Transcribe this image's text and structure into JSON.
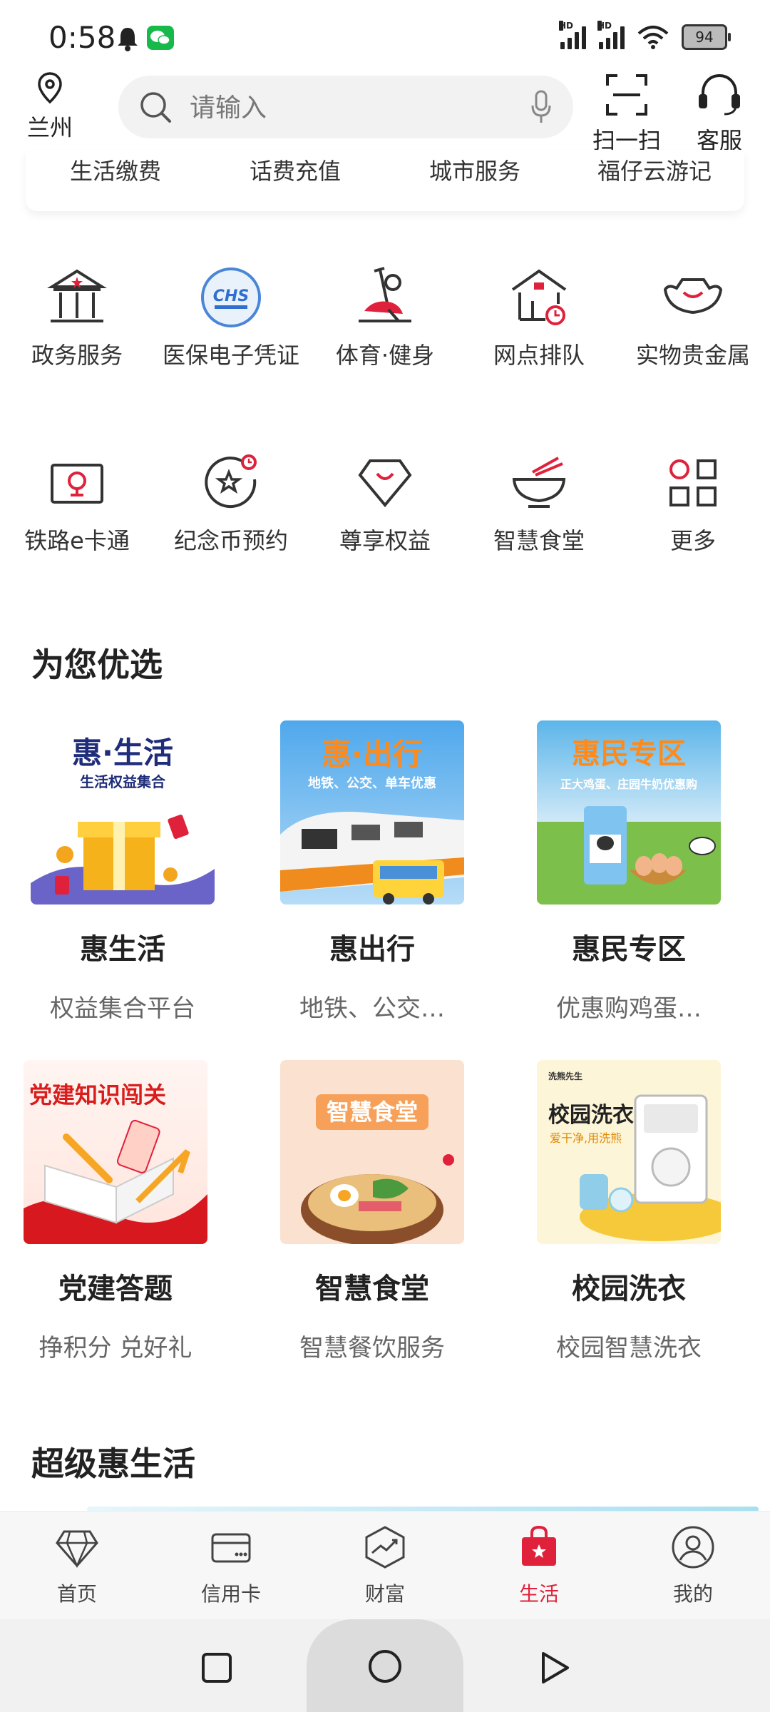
{
  "status_bar": {
    "time": "0:58",
    "battery": "94"
  },
  "header": {
    "location": "兰州",
    "search_placeholder": "请输入",
    "scan_label": "扫一扫",
    "service_label": "客服"
  },
  "quick_links": [
    "生活缴费",
    "话费充值",
    "城市服务",
    "福仔云游记"
  ],
  "grid": [
    {
      "label": "政务服务",
      "icon": "government-icon"
    },
    {
      "label": "医保电子凭证",
      "icon": "chs-medical-insurance-icon"
    },
    {
      "label": "体育·健身",
      "icon": "exercise-bike-icon"
    },
    {
      "label": "网点排队",
      "icon": "branch-queue-icon"
    },
    {
      "label": "实物贵金属",
      "icon": "gold-ingot-icon"
    },
    {
      "label": "铁路e卡通",
      "icon": "railway-card-icon"
    },
    {
      "label": "纪念币预约",
      "icon": "commemorative-coin-icon"
    },
    {
      "label": "尊享权益",
      "icon": "diamond-icon"
    },
    {
      "label": "智慧食堂",
      "icon": "bowl-icon"
    },
    {
      "label": "更多",
      "icon": "more-grid-icon"
    }
  ],
  "featured": {
    "title": "为您优选",
    "cards": [
      {
        "title": "惠生活",
        "subtitle": "权益集合平台",
        "banner_title": "惠·生活",
        "banner_sub": "生活权益集合"
      },
      {
        "title": "惠出行",
        "subtitle": "地铁、公交…",
        "banner_title": "惠·出行",
        "banner_sub": "地铁、公交、单车优惠"
      },
      {
        "title": "惠民专区",
        "subtitle": "优惠购鸡蛋…",
        "banner_title": "惠民专区",
        "banner_sub": "正大鸡蛋、庄园牛奶优惠购"
      },
      {
        "title": "党建答题",
        "subtitle": "挣积分 兑好礼",
        "banner_title": "党建知识闯关",
        "banner_sub": ""
      },
      {
        "title": "智慧食堂",
        "subtitle": "智慧餐饮服务",
        "banner_title": "智慧食堂",
        "banner_sub": ""
      },
      {
        "title": "校园洗衣",
        "subtitle": "校园智慧洗衣",
        "banner_title": "校园洗衣",
        "banner_sub": "爱干净,用洗熊",
        "banner_brand": "洗熊先生"
      }
    ]
  },
  "super_section": {
    "title": "超级惠生活"
  },
  "tabbar": [
    {
      "label": "首页",
      "icon": "diamond-home-icon"
    },
    {
      "label": "信用卡",
      "icon": "credit-card-icon"
    },
    {
      "label": "财富",
      "icon": "wealth-chart-icon"
    },
    {
      "label": "生活",
      "icon": "shopping-bag-icon",
      "active": true
    },
    {
      "label": "我的",
      "icon": "profile-icon"
    }
  ],
  "colors": {
    "accent": "#e0213c",
    "text_secondary": "#666666"
  }
}
